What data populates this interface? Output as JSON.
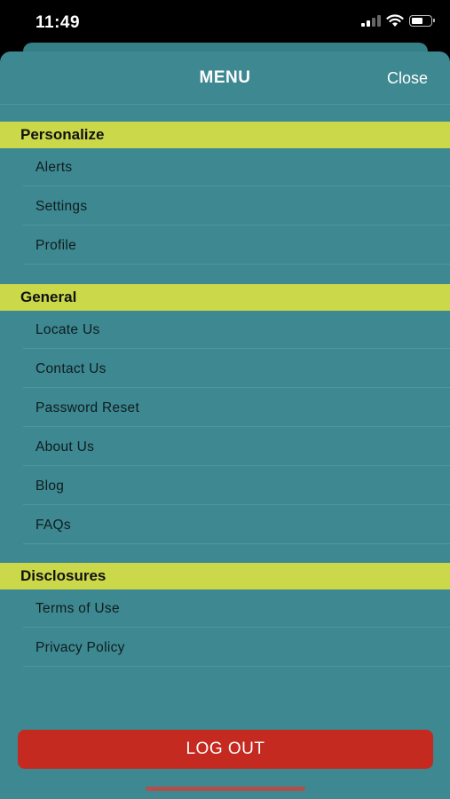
{
  "status_bar": {
    "time": "11:49"
  },
  "header": {
    "title": "MENU",
    "close_label": "Close"
  },
  "sections": [
    {
      "title": "Personalize",
      "items": [
        "Alerts",
        "Settings",
        "Profile"
      ]
    },
    {
      "title": "General",
      "items": [
        "Locate Us",
        "Contact Us",
        "Password Reset",
        "About Us",
        "Blog",
        "FAQs"
      ]
    },
    {
      "title": "Disclosures",
      "items": [
        "Terms of Use",
        "Privacy Policy"
      ]
    }
  ],
  "logout_label": "LOG OUT",
  "colors": {
    "background": "#3d8891",
    "section_header": "#cbd84a",
    "logout": "#c52a20"
  },
  "icons": [
    "signal-icon",
    "wifi-icon",
    "battery-icon"
  ]
}
